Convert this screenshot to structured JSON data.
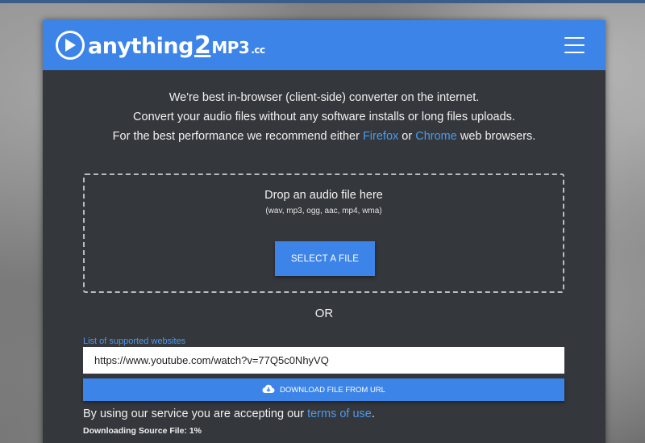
{
  "header": {
    "logo_prefix": "anything",
    "logo_two": "2",
    "logo_mp3": "MP3",
    "logo_cc": ".cc",
    "menu_icon": "hamburger-menu-icon"
  },
  "intro": {
    "line1": "We're best in-browser (client-side) converter on the internet.",
    "line2": "Convert your audio files without any software installs or long files uploads.",
    "line3_prefix": "For the best performance we recommend either ",
    "firefox_link": "Firefox",
    "line3_mid": " or ",
    "chrome_link": "Chrome",
    "line3_suffix": " web browsers."
  },
  "dropzone": {
    "title": "Drop an audio file here",
    "formats": "(wav, mp3, ogg, aac, mp4, wma)",
    "select_button": "SELECT A FILE"
  },
  "or_label": "OR",
  "url_section": {
    "supported_link": "List of supported websites",
    "url_value": "https://www.youtube.com/watch?v=77Q5c0NhyVQ",
    "download_button": "DOWNLOAD FILE FROM URL",
    "download_icon": "cloud-download-icon"
  },
  "terms": {
    "prefix": "By using our service you are accepting our ",
    "link": "terms of use",
    "suffix": "."
  },
  "status": {
    "label": "Downloading Source File: 1%"
  },
  "colors": {
    "accent": "#3c84e8",
    "link": "#4a9bef",
    "panel": "#34373c"
  }
}
